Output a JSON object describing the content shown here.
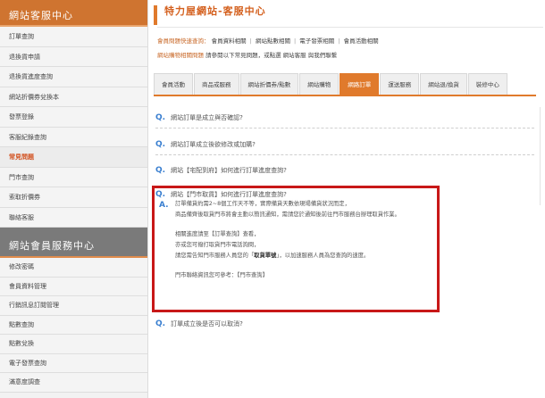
{
  "sidebar": {
    "header": "網站客服中心",
    "items": [
      {
        "label": "訂單查詢"
      },
      {
        "label": "退換貨申請"
      },
      {
        "label": "退換貨進度查詢"
      },
      {
        "label": "網站折價券兌換本"
      },
      {
        "label": "發票登錄"
      },
      {
        "label": "客服紀錄查詢"
      },
      {
        "label": "常見問題",
        "active": true
      },
      {
        "label": "門市查詢"
      },
      {
        "label": "索取折價券"
      },
      {
        "label": "聯絡客服"
      }
    ],
    "header2": "網站會員服務中心",
    "items2": [
      {
        "label": "修改密碼"
      },
      {
        "label": "會員資料管理"
      },
      {
        "label": "行銷訊息訂閱管理"
      },
      {
        "label": "點數查詢"
      },
      {
        "label": "點數兌換"
      },
      {
        "label": "電子發票查詢"
      },
      {
        "label": "滿意度調查"
      }
    ]
  },
  "header": {
    "title": "特力屋網站-客服中心"
  },
  "quick": {
    "label": "會員問題快速查詢：",
    "links": [
      "會員資料相關",
      "網站點數相關",
      "電子發票相關",
      "會員活動相關"
    ]
  },
  "notice": {
    "highlight": "網站購物相關問題",
    "text": " 請參閱以下常見問題，或點選 網站客服 與我們聯繫"
  },
  "tabs": [
    {
      "label": "會員活動"
    },
    {
      "label": "商品或服務"
    },
    {
      "label": "網站折價券/點數"
    },
    {
      "label": "網站購物"
    },
    {
      "label": "網路訂單",
      "active": true
    },
    {
      "label": "運送服務"
    },
    {
      "label": "網站退/換貨"
    },
    {
      "label": "裝修中心"
    }
  ],
  "faq": {
    "q_mark": "Q.",
    "a_mark": "A.",
    "questions": [
      "網站訂單是成立與否確認?",
      "網站訂單成立後欲修改或加購?",
      "網站【宅配到府】如何進行訂單進度查詢?",
      "網站【門市取貨】如何進行訂單進度查詢?",
      "訂單成立後是否可以取消?"
    ],
    "answer": {
      "line1": "訂單備貨約需2~8個工作天不等，實際備貨天數依現場備貨狀況而定，",
      "line2": "商品備齊後取貨門市將會主動以簡訊通知，需請您於通知後前往門市服務台辦理取貨作業。",
      "line3": "相關進度請至【訂單查詢】查看，",
      "line4": "亦或您可撥打取貨門市電話詢問，",
      "line5_pre": "請您需告知門市服務人員您的「",
      "line5_bold": "取貨單號",
      "line5_post": "」，以加速服務人員為您查詢的速度。",
      "line6": "門市聯絡資訊您可參考：【門市查詢】"
    }
  }
}
